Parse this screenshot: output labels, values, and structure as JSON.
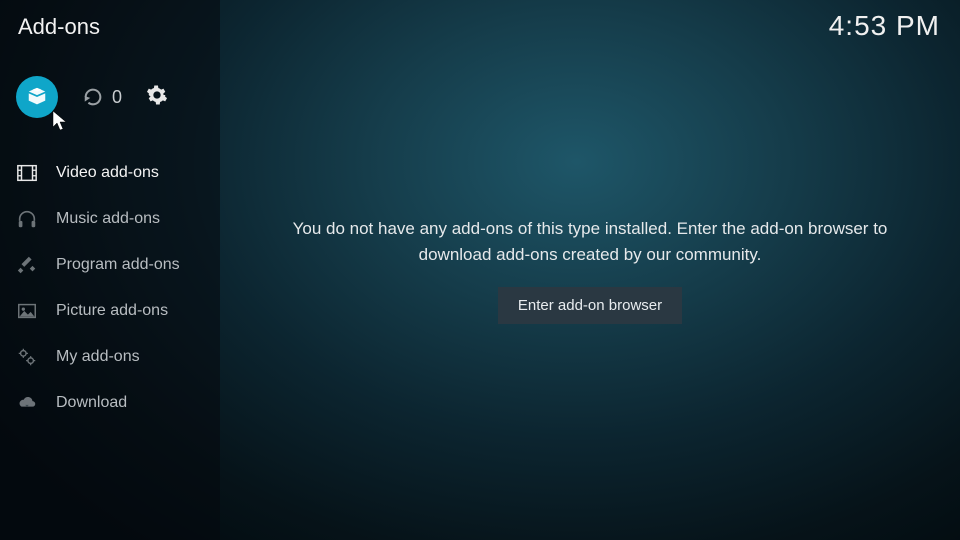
{
  "header": {
    "title": "Add-ons",
    "clock": "4:53 PM"
  },
  "top": {
    "update_count": "0"
  },
  "sidebar": {
    "items": [
      {
        "label": "Video add-ons"
      },
      {
        "label": "Music add-ons"
      },
      {
        "label": "Program add-ons"
      },
      {
        "label": "Picture add-ons"
      },
      {
        "label": "My add-ons"
      },
      {
        "label": "Download"
      }
    ]
  },
  "main": {
    "empty_message": "You do not have any add-ons of this type installed. Enter the add-on browser to download add-ons created by our community.",
    "button_label": "Enter add-on browser"
  }
}
